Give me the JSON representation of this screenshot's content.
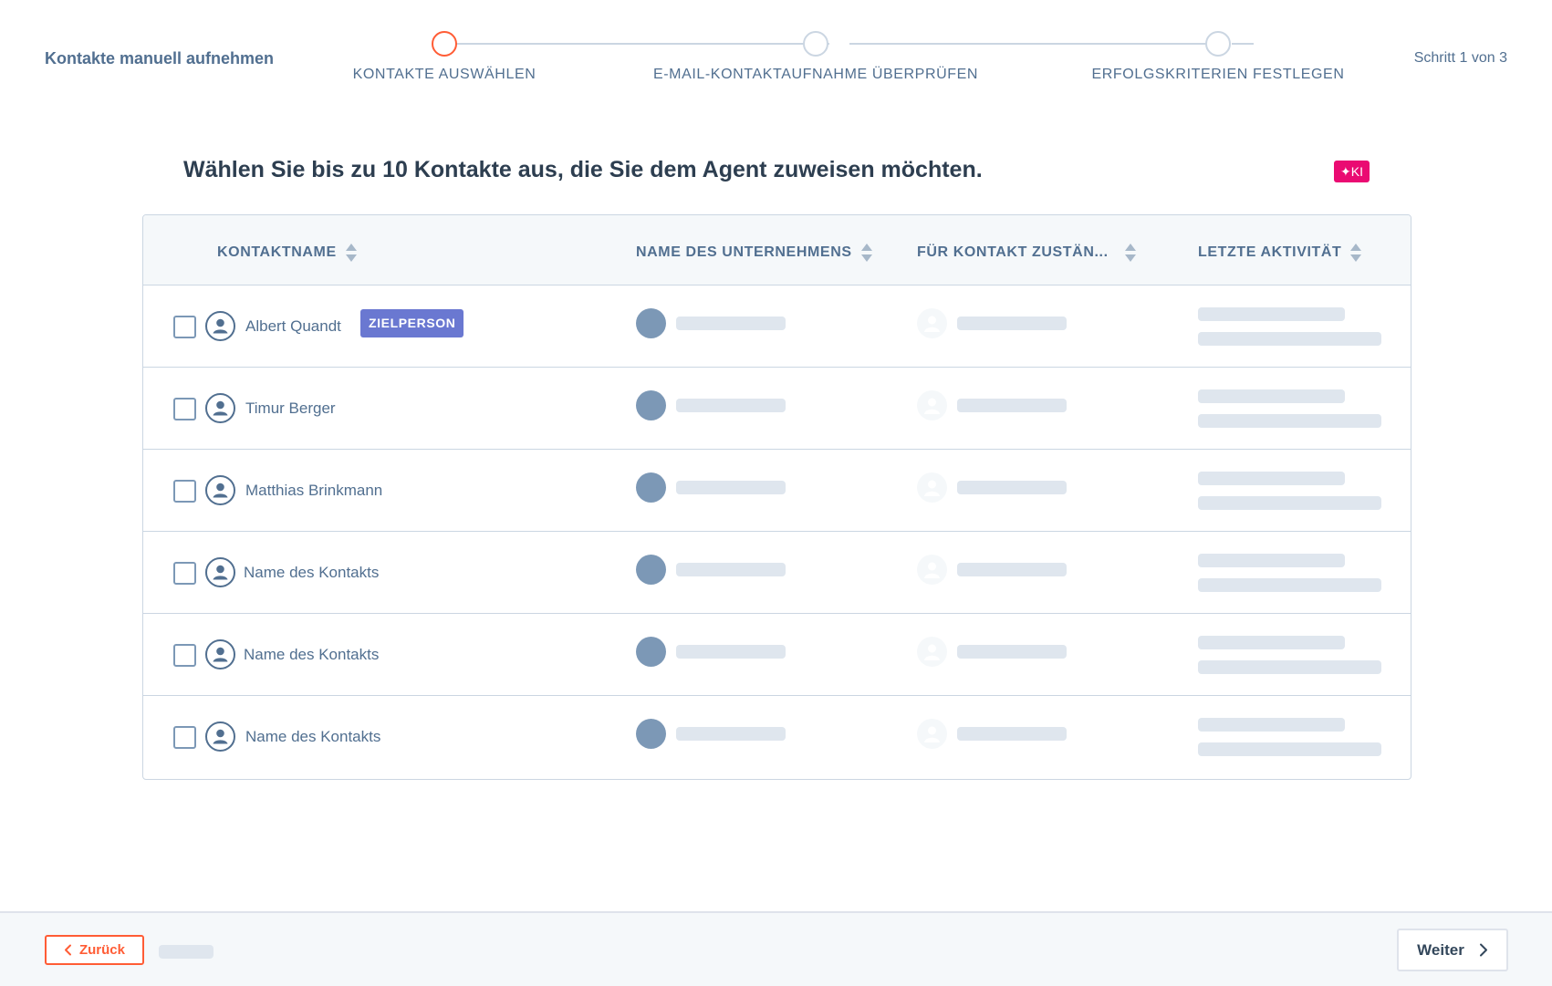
{
  "header": {
    "title": "Kontakte manuell aufnehmen",
    "step_count": "Schritt 1 von 3"
  },
  "stepper": {
    "steps": [
      {
        "label": "KONTAKTE AUSWÄHLEN",
        "active": true
      },
      {
        "label": "E-MAIL-KONTAKTAUFNAHME ÜBERPRÜFEN",
        "active": false
      },
      {
        "label": "ERFOLGSKRITERIEN FESTLEGEN",
        "active": false
      }
    ]
  },
  "intro": {
    "heading": "Wählen Sie bis zu 10 Kontakte aus, die Sie dem Agent zuweisen möchten.",
    "ai_badge": "✦KI"
  },
  "table": {
    "columns": [
      "KONTAKTNAME",
      "NAME DES UNTERNEHMENS",
      "FÜR KONTAKT ZUSTÄN...",
      "LETZTE AKTIVITÄT"
    ],
    "rows": [
      {
        "name": "Albert Quandt",
        "tag": "ZIELPERSON",
        "checked": false
      },
      {
        "name": "Timur Berger",
        "tag": "",
        "checked": false
      },
      {
        "name": "Matthias Brinkmann",
        "tag": "",
        "checked": false
      },
      {
        "name": "Name des Kontakts",
        "tag": "",
        "checked": false
      },
      {
        "name": "Name des Kontakts",
        "tag": "",
        "checked": false
      },
      {
        "name": "Name des Kontakts",
        "tag": "",
        "checked": false
      }
    ]
  },
  "footer": {
    "back_label": "Zurück",
    "next_label": "Weiter"
  },
  "colors": {
    "accent": "#ff5c35",
    "tag": "#6a78d1",
    "ai_badge": "#ea0b72",
    "skeleton": "#dfe6ee",
    "text": "#516f90"
  },
  "icons": {
    "contact_avatar": "person-circle-icon",
    "sort": "sort-updown-icon",
    "back": "chevron-left-icon",
    "next": "chevron-right-icon"
  }
}
